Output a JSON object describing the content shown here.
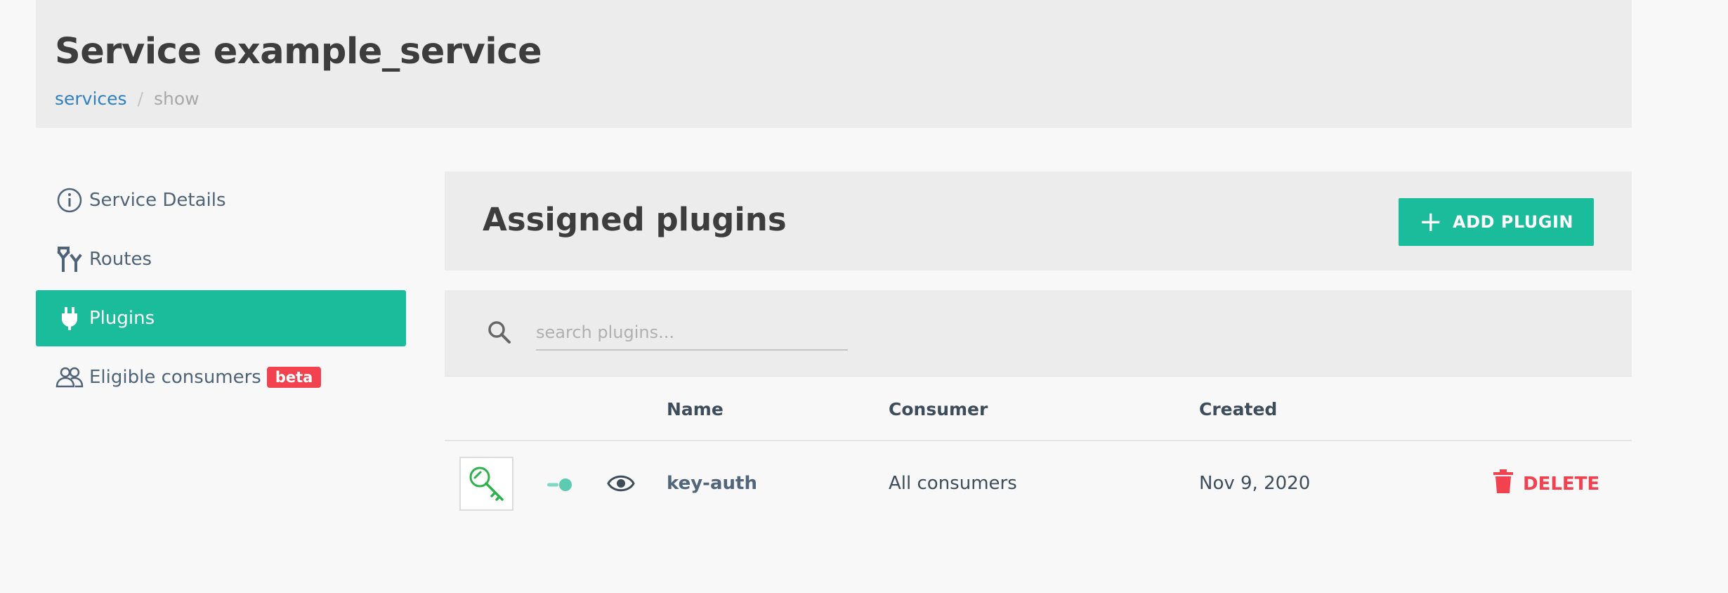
{
  "header": {
    "title": "Service example_service",
    "breadcrumb": {
      "link": "services",
      "separator": "/",
      "current": "show"
    }
  },
  "sidebar": {
    "items": [
      {
        "label": "Service Details",
        "icon": "info-icon"
      },
      {
        "label": "Routes",
        "icon": "routes-icon"
      },
      {
        "label": "Plugins",
        "icon": "plug-icon",
        "active": true
      },
      {
        "label": "Eligible consumers",
        "icon": "users-icon",
        "badge": "beta"
      }
    ]
  },
  "main": {
    "title": "Assigned plugins",
    "add_button": "ADD PLUGIN",
    "search": {
      "placeholder": "search plugins..."
    },
    "table": {
      "columns": [
        "Name",
        "Consumer",
        "Created"
      ],
      "rows": [
        {
          "name": "key-auth",
          "consumer": "All consumers",
          "created": "Nov 9, 2020",
          "enabled": true,
          "action": "DELETE"
        }
      ]
    }
  },
  "colors": {
    "accent": "#1bbc9b",
    "danger": "#f2424f",
    "link": "#2f7fc1",
    "header_bg": "#ececec"
  }
}
